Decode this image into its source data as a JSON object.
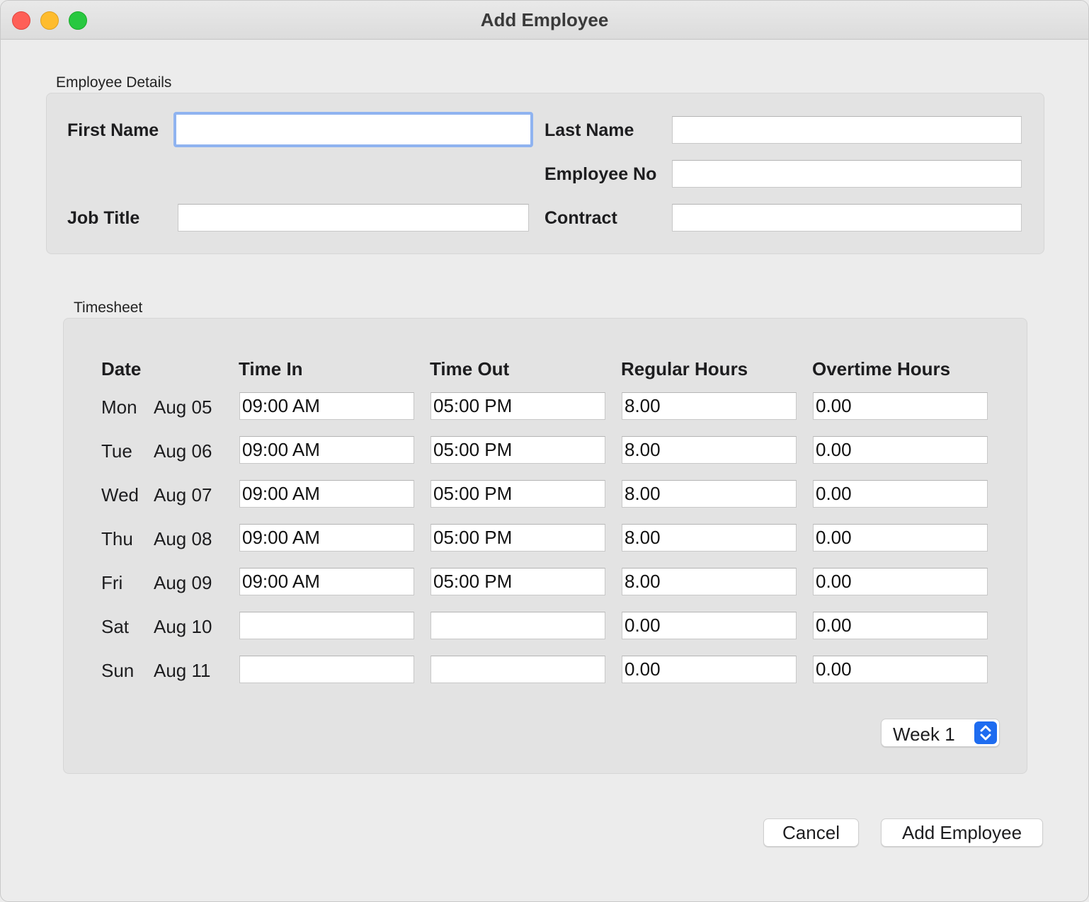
{
  "window": {
    "title": "Add Employee"
  },
  "details": {
    "caption": "Employee Details",
    "first_name": {
      "label": "First Name",
      "value": ""
    },
    "last_name": {
      "label": "Last Name",
      "value": ""
    },
    "employee_no": {
      "label": "Employee No",
      "value": ""
    },
    "job_title": {
      "label": "Job Title",
      "value": ""
    },
    "contract": {
      "label": "Contract",
      "value": ""
    }
  },
  "timesheet": {
    "caption": "Timesheet",
    "columns": [
      "Date",
      "Time In",
      "Time Out",
      "Regular Hours",
      "Overtime Hours"
    ],
    "rows": [
      {
        "day": "Mon",
        "date": "Aug 05",
        "time_in": "09:00 AM",
        "time_out": "05:00 PM",
        "regular": "8.00",
        "overtime": "0.00"
      },
      {
        "day": "Tue",
        "date": "Aug 06",
        "time_in": "09:00 AM",
        "time_out": "05:00 PM",
        "regular": "8.00",
        "overtime": "0.00"
      },
      {
        "day": "Wed",
        "date": "Aug 07",
        "time_in": "09:00 AM",
        "time_out": "05:00 PM",
        "regular": "8.00",
        "overtime": "0.00"
      },
      {
        "day": "Thu",
        "date": "Aug 08",
        "time_in": "09:00 AM",
        "time_out": "05:00 PM",
        "regular": "8.00",
        "overtime": "0.00"
      },
      {
        "day": "Fri",
        "date": "Aug 09",
        "time_in": "09:00 AM",
        "time_out": "05:00 PM",
        "regular": "8.00",
        "overtime": "0.00"
      },
      {
        "day": "Sat",
        "date": "Aug 10",
        "time_in": "",
        "time_out": "",
        "regular": "0.00",
        "overtime": "0.00"
      },
      {
        "day": "Sun",
        "date": "Aug 11",
        "time_in": "",
        "time_out": "",
        "regular": "0.00",
        "overtime": "0.00"
      }
    ],
    "week_select": {
      "value": "Week 1"
    }
  },
  "buttons": {
    "cancel": "Cancel",
    "add": "Add Employee"
  },
  "colors": {
    "accent": "#1e6cf0",
    "focus_ring": "#8fb3f0",
    "background": "#ececec"
  }
}
